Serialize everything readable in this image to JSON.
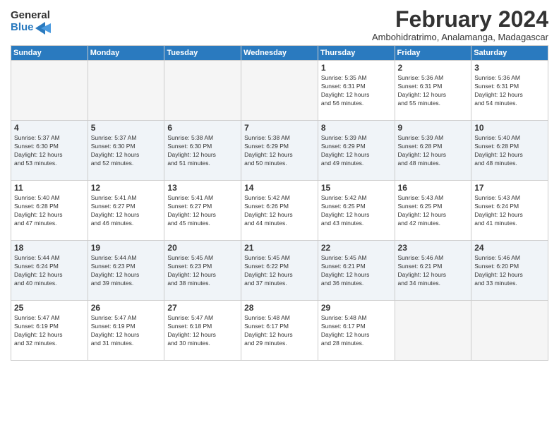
{
  "logo": {
    "text_general": "General",
    "text_blue": "Blue"
  },
  "title": {
    "month_year": "February 2024",
    "location": "Ambohidratrimo, Analamanga, Madagascar"
  },
  "days_of_week": [
    "Sunday",
    "Monday",
    "Tuesday",
    "Wednesday",
    "Thursday",
    "Friday",
    "Saturday"
  ],
  "weeks": [
    {
      "shade": false,
      "days": [
        {
          "num": "",
          "info": ""
        },
        {
          "num": "",
          "info": ""
        },
        {
          "num": "",
          "info": ""
        },
        {
          "num": "",
          "info": ""
        },
        {
          "num": "1",
          "info": "Sunrise: 5:35 AM\nSunset: 6:31 PM\nDaylight: 12 hours\nand 56 minutes."
        },
        {
          "num": "2",
          "info": "Sunrise: 5:36 AM\nSunset: 6:31 PM\nDaylight: 12 hours\nand 55 minutes."
        },
        {
          "num": "3",
          "info": "Sunrise: 5:36 AM\nSunset: 6:31 PM\nDaylight: 12 hours\nand 54 minutes."
        }
      ]
    },
    {
      "shade": true,
      "days": [
        {
          "num": "4",
          "info": "Sunrise: 5:37 AM\nSunset: 6:30 PM\nDaylight: 12 hours\nand 53 minutes."
        },
        {
          "num": "5",
          "info": "Sunrise: 5:37 AM\nSunset: 6:30 PM\nDaylight: 12 hours\nand 52 minutes."
        },
        {
          "num": "6",
          "info": "Sunrise: 5:38 AM\nSunset: 6:30 PM\nDaylight: 12 hours\nand 51 minutes."
        },
        {
          "num": "7",
          "info": "Sunrise: 5:38 AM\nSunset: 6:29 PM\nDaylight: 12 hours\nand 50 minutes."
        },
        {
          "num": "8",
          "info": "Sunrise: 5:39 AM\nSunset: 6:29 PM\nDaylight: 12 hours\nand 49 minutes."
        },
        {
          "num": "9",
          "info": "Sunrise: 5:39 AM\nSunset: 6:28 PM\nDaylight: 12 hours\nand 48 minutes."
        },
        {
          "num": "10",
          "info": "Sunrise: 5:40 AM\nSunset: 6:28 PM\nDaylight: 12 hours\nand 48 minutes."
        }
      ]
    },
    {
      "shade": false,
      "days": [
        {
          "num": "11",
          "info": "Sunrise: 5:40 AM\nSunset: 6:28 PM\nDaylight: 12 hours\nand 47 minutes."
        },
        {
          "num": "12",
          "info": "Sunrise: 5:41 AM\nSunset: 6:27 PM\nDaylight: 12 hours\nand 46 minutes."
        },
        {
          "num": "13",
          "info": "Sunrise: 5:41 AM\nSunset: 6:27 PM\nDaylight: 12 hours\nand 45 minutes."
        },
        {
          "num": "14",
          "info": "Sunrise: 5:42 AM\nSunset: 6:26 PM\nDaylight: 12 hours\nand 44 minutes."
        },
        {
          "num": "15",
          "info": "Sunrise: 5:42 AM\nSunset: 6:25 PM\nDaylight: 12 hours\nand 43 minutes."
        },
        {
          "num": "16",
          "info": "Sunrise: 5:43 AM\nSunset: 6:25 PM\nDaylight: 12 hours\nand 42 minutes."
        },
        {
          "num": "17",
          "info": "Sunrise: 5:43 AM\nSunset: 6:24 PM\nDaylight: 12 hours\nand 41 minutes."
        }
      ]
    },
    {
      "shade": true,
      "days": [
        {
          "num": "18",
          "info": "Sunrise: 5:44 AM\nSunset: 6:24 PM\nDaylight: 12 hours\nand 40 minutes."
        },
        {
          "num": "19",
          "info": "Sunrise: 5:44 AM\nSunset: 6:23 PM\nDaylight: 12 hours\nand 39 minutes."
        },
        {
          "num": "20",
          "info": "Sunrise: 5:45 AM\nSunset: 6:23 PM\nDaylight: 12 hours\nand 38 minutes."
        },
        {
          "num": "21",
          "info": "Sunrise: 5:45 AM\nSunset: 6:22 PM\nDaylight: 12 hours\nand 37 minutes."
        },
        {
          "num": "22",
          "info": "Sunrise: 5:45 AM\nSunset: 6:21 PM\nDaylight: 12 hours\nand 36 minutes."
        },
        {
          "num": "23",
          "info": "Sunrise: 5:46 AM\nSunset: 6:21 PM\nDaylight: 12 hours\nand 34 minutes."
        },
        {
          "num": "24",
          "info": "Sunrise: 5:46 AM\nSunset: 6:20 PM\nDaylight: 12 hours\nand 33 minutes."
        }
      ]
    },
    {
      "shade": false,
      "days": [
        {
          "num": "25",
          "info": "Sunrise: 5:47 AM\nSunset: 6:19 PM\nDaylight: 12 hours\nand 32 minutes."
        },
        {
          "num": "26",
          "info": "Sunrise: 5:47 AM\nSunset: 6:19 PM\nDaylight: 12 hours\nand 31 minutes."
        },
        {
          "num": "27",
          "info": "Sunrise: 5:47 AM\nSunset: 6:18 PM\nDaylight: 12 hours\nand 30 minutes."
        },
        {
          "num": "28",
          "info": "Sunrise: 5:48 AM\nSunset: 6:17 PM\nDaylight: 12 hours\nand 29 minutes."
        },
        {
          "num": "29",
          "info": "Sunrise: 5:48 AM\nSunset: 6:17 PM\nDaylight: 12 hours\nand 28 minutes."
        },
        {
          "num": "",
          "info": ""
        },
        {
          "num": "",
          "info": ""
        }
      ]
    }
  ]
}
